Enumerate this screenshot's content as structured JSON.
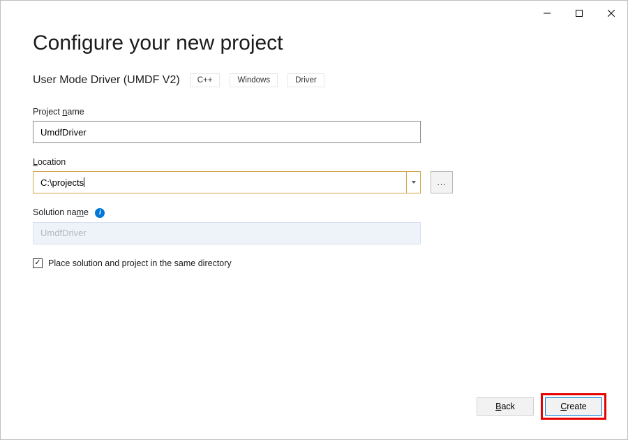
{
  "window": {
    "minimize": "—",
    "maximize": "☐",
    "close": "✕"
  },
  "page_title": "Configure your new project",
  "template": {
    "name": "User Mode Driver (UMDF V2)",
    "tags": [
      "C++",
      "Windows",
      "Driver"
    ]
  },
  "fields": {
    "project_name": {
      "label_pre": "Project ",
      "label_ul": "n",
      "label_post": "ame",
      "value": "UmdfDriver"
    },
    "location": {
      "label_ul": "L",
      "label_post": "ocation",
      "value": "C:\\projects",
      "browse": "..."
    },
    "solution_name": {
      "label_pre": "Solution na",
      "label_ul": "m",
      "label_post": "e",
      "info": "i",
      "placeholder": "UmdfDriver"
    },
    "same_dir": {
      "check": "✓",
      "label_pre": "Place solution and project in the same ",
      "label_ul": "d",
      "label_post": "irectory"
    }
  },
  "footer": {
    "back_ul": "B",
    "back_post": "ack",
    "create_ul": "C",
    "create_post": "reate"
  }
}
